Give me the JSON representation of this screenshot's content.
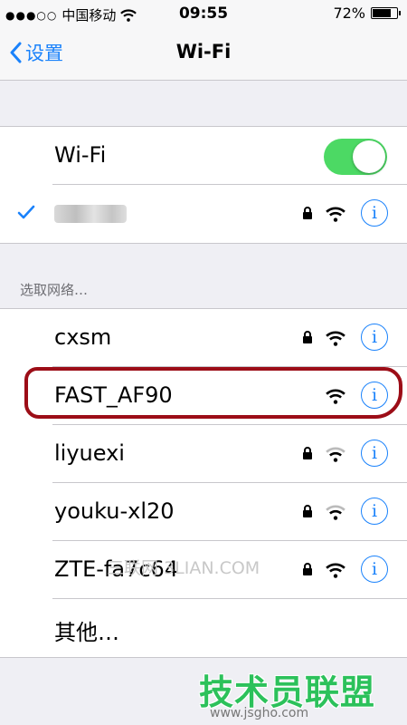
{
  "status_bar": {
    "carrier": "中国移动",
    "time": "09:55",
    "battery": "72%",
    "signal_dots": "●●●○○"
  },
  "nav": {
    "back_label": "设置",
    "title": "Wi-Fi"
  },
  "wifi_toggle": {
    "label": "Wi-Fi",
    "on": true
  },
  "connected_network": {
    "secured": true
  },
  "section_header": "选取网络…",
  "networks": [
    {
      "name": "cxsm",
      "secured": true
    },
    {
      "name": "FAST_AF90",
      "secured": false
    },
    {
      "name": "liyuexi",
      "secured": true
    },
    {
      "name": "youku-xl20",
      "secured": true
    },
    {
      "name": "ZTE-fa7c64",
      "secured": true
    },
    {
      "name": "其他…"
    }
  ],
  "watermark": "三联网 3LIAN.COM",
  "brand": {
    "name": "技术员联盟",
    "url": "www.jsgho.com"
  },
  "colors": {
    "accent": "#1a82fb",
    "toggle_on": "#4cd964",
    "highlight": "#9c0d17"
  }
}
